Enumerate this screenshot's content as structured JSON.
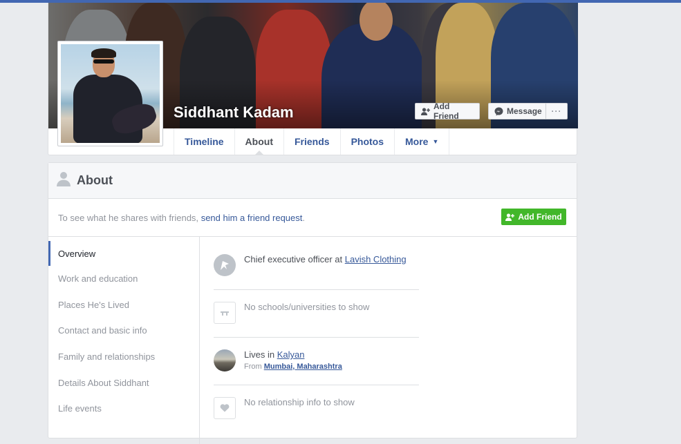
{
  "profile": {
    "name": "Siddhant Kadam",
    "add_friend_label": "Add Friend",
    "message_label": "Message",
    "more_label": "···"
  },
  "tabs": [
    {
      "label": "Timeline"
    },
    {
      "label": "About"
    },
    {
      "label": "Friends"
    },
    {
      "label": "Photos"
    },
    {
      "label": "More"
    }
  ],
  "about": {
    "title": "About",
    "notice_prefix": "To see what he shares with friends, ",
    "notice_link": "send him a friend request",
    "notice_suffix": ".",
    "add_friend_label": "Add Friend",
    "nav": [
      {
        "label": "Overview"
      },
      {
        "label": "Work and education"
      },
      {
        "label": "Places He's Lived"
      },
      {
        "label": "Contact and basic info"
      },
      {
        "label": "Family and relationships"
      },
      {
        "label": "Details About Siddhant"
      },
      {
        "label": "Life events"
      }
    ],
    "overview": {
      "work_prefix": "Chief executive officer at ",
      "work_link": "Lavish Clothing",
      "education": "No schools/universities to show",
      "lives_prefix": "Lives in ",
      "lives_link": "Kalyan",
      "from_prefix": "From ",
      "from_link": "Mumbai, Maharashtra",
      "relationship": "No relationship info to show"
    }
  },
  "colors": {
    "link": "#365899",
    "green": "#42b72a",
    "nav_active": "#4267b2"
  }
}
